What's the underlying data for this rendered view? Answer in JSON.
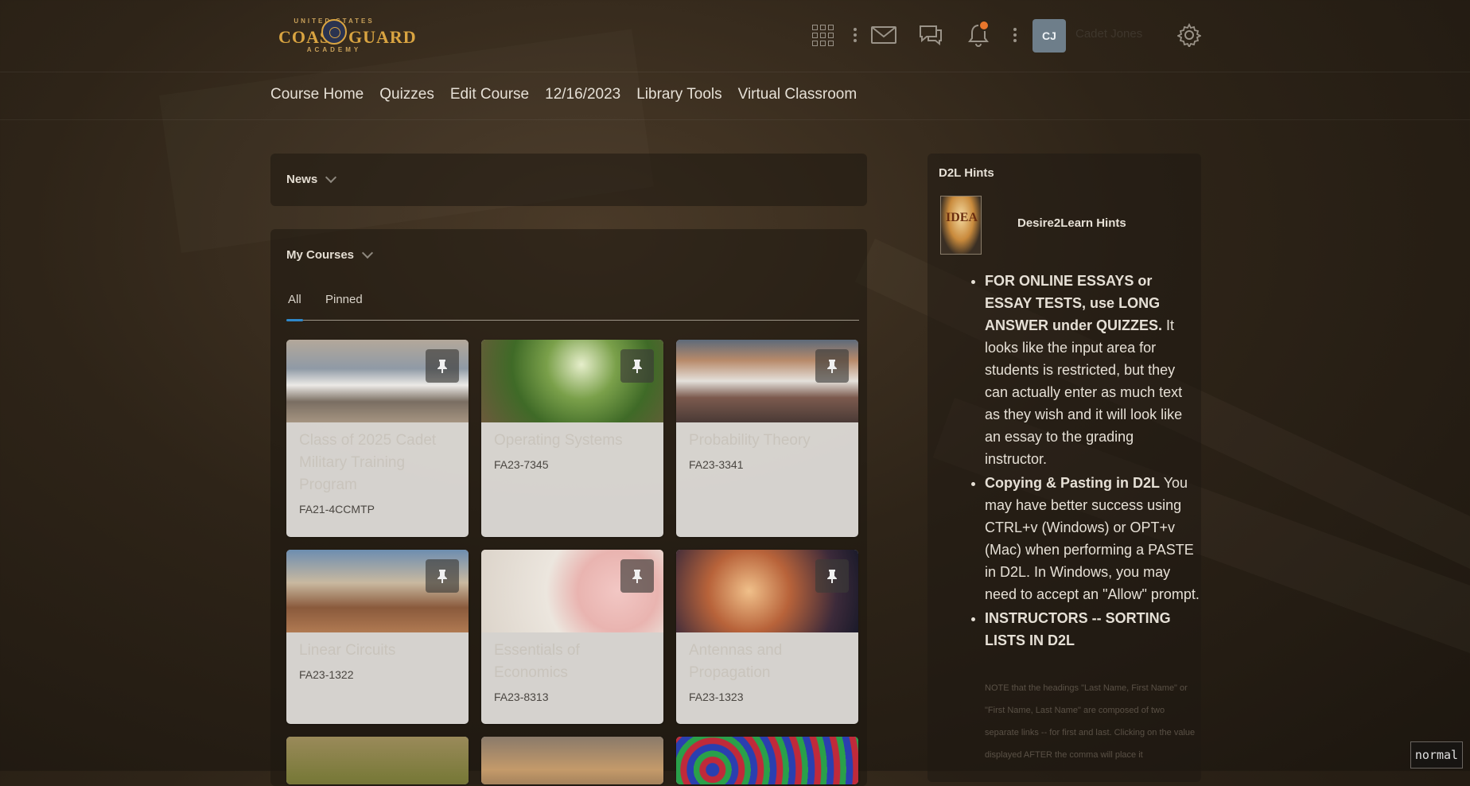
{
  "header": {
    "logo_top": "UNITED STATES",
    "logo_left": "COAST",
    "logo_right": "GUARD",
    "logo_bottom": "ACADEMY",
    "avatar_initials": "CJ",
    "user_name": "Cadet Jones",
    "icons": [
      "grid-icon",
      "kebab-icon",
      "mail-icon",
      "chat-icon",
      "bell-icon",
      "kebab-icon",
      "gear-icon"
    ],
    "notification_color": "#e8762c"
  },
  "nav": {
    "items": [
      "Course Home",
      "Quizzes",
      "Edit Course",
      "12/16/2023",
      "Library Tools",
      "Virtual Classroom"
    ]
  },
  "news": {
    "title": "News"
  },
  "my_courses": {
    "title": "My Courses",
    "tabs": [
      "All",
      "Pinned"
    ],
    "active_tab": "All",
    "accent_color": "#2f88c9",
    "courses": [
      {
        "title": "Class of 2025 Cadet Military Training Program",
        "code": "FA21-4CCMTP"
      },
      {
        "title": "Operating Systems",
        "code": "FA23-7345"
      },
      {
        "title": "Probability Theory",
        "code": "FA23-3341"
      },
      {
        "title": "Linear Circuits",
        "code": "FA23-1322"
      },
      {
        "title": "Essentials of Economics",
        "code": "FA23-8313"
      },
      {
        "title": "Antennas and Propagation",
        "code": "FA23-1323"
      }
    ]
  },
  "hints": {
    "heading": "D2L Hints",
    "name": "Desire2Learn Hints",
    "image_label": "IDEA",
    "item1_bold": "FOR ONLINE ESSAYS or ESSAY TESTS, use LONG ANSWER under QUIZZES.",
    "item1_text": " It looks like the input area for students is restricted, but they can actually enter as much text as they wish and it will look like an essay to the grading instructor.",
    "item2_bold": "Copying & Pasting in D2L",
    "item2_text": " You may have better success using CTRL+v (Windows) or OPT+v (Mac) when performing a PASTE in D2L. In Windows, you may need to accept an \"Allow\" prompt.",
    "item3_bold": "INSTRUCTORS -- SORTING LISTS IN D2L",
    "note": "NOTE that the headings \"Last Name, First Name\" or \"First Name, Last Name\" are composed of two separate links -- for first and last. Clicking on the value displayed AFTER the comma will place it"
  },
  "mode": "normal"
}
